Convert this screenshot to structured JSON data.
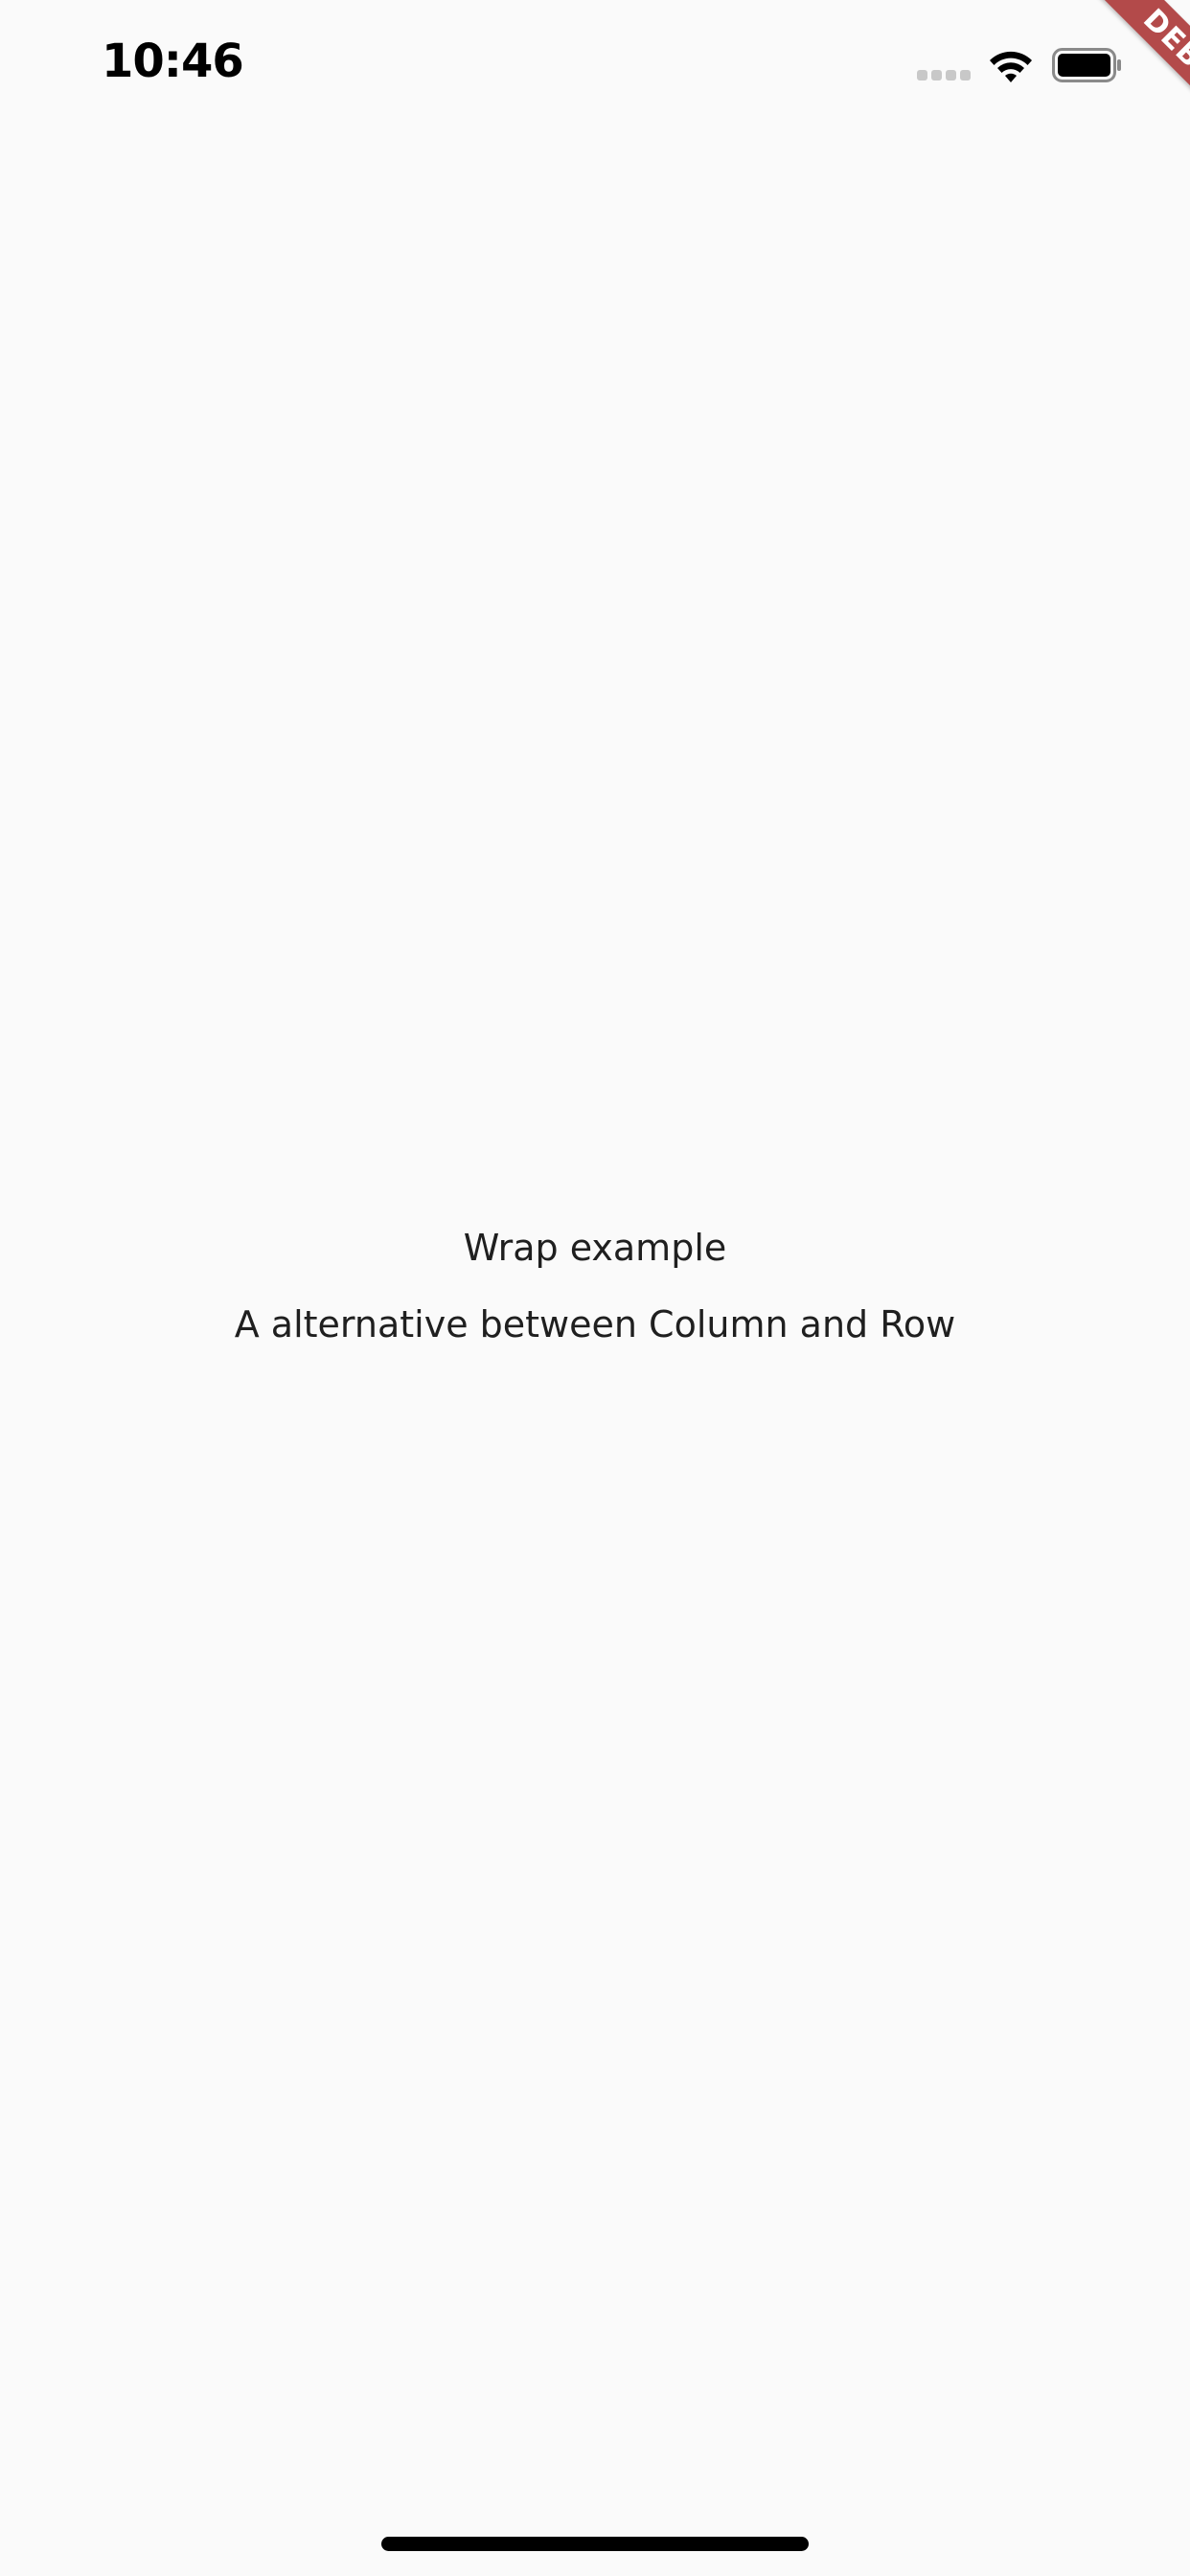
{
  "status_bar": {
    "time": "10:46",
    "signal_icon": "signal-bars-icon",
    "wifi_icon": "wifi-icon",
    "battery_icon": "battery-icon"
  },
  "debug_banner": {
    "label": "DEBUG",
    "color": "#b34a4a"
  },
  "main": {
    "title": "Wrap example",
    "subtitle": "A alternative between Column and Row"
  },
  "colors": {
    "background": "#fafafa",
    "text": "#1f1f1f"
  }
}
